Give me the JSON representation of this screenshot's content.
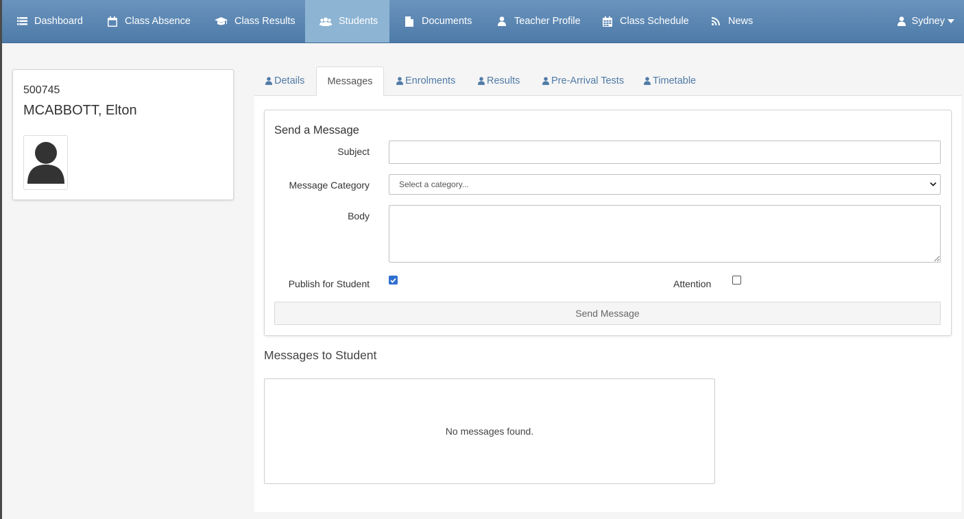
{
  "nav": {
    "items": [
      {
        "label": "Dashboard",
        "icon": "dashboard-icon"
      },
      {
        "label": "Class Absence",
        "icon": "calendar-icon"
      },
      {
        "label": "Class Results",
        "icon": "graduation-cap-icon"
      },
      {
        "label": "Students",
        "icon": "users-icon",
        "active": true
      },
      {
        "label": "Documents",
        "icon": "document-icon"
      },
      {
        "label": "Teacher Profile",
        "icon": "user-icon"
      },
      {
        "label": "Class Schedule",
        "icon": "calendar-grid-icon"
      },
      {
        "label": "News",
        "icon": "rss-icon"
      }
    ],
    "user": "Sydney"
  },
  "student": {
    "id": "500745",
    "name": "MCABBOTT, Elton"
  },
  "tabs": [
    {
      "label": "Details",
      "active": false
    },
    {
      "label": "Messages",
      "active": true
    },
    {
      "label": "Enrolments",
      "active": false
    },
    {
      "label": "Results",
      "active": false
    },
    {
      "label": "Pre-Arrival Tests",
      "active": false
    },
    {
      "label": "Timetable",
      "active": false
    }
  ],
  "form": {
    "title": "Send a Message",
    "subject_label": "Subject",
    "subject_value": "",
    "category_label": "Message Category",
    "category_value": "Select a category...",
    "body_label": "Body",
    "body_value": "",
    "publish_label": "Publish for Student",
    "publish_checked": true,
    "attention_label": "Attention",
    "attention_checked": false,
    "send_label": "Send Message"
  },
  "messages": {
    "heading": "Messages to Student",
    "empty_text": "No messages found."
  },
  "colors": {
    "navbar": "#5a86b2",
    "nav_active": "#8db4d3",
    "link": "#4f7aa6",
    "checkbox": "#2f6fd0"
  }
}
